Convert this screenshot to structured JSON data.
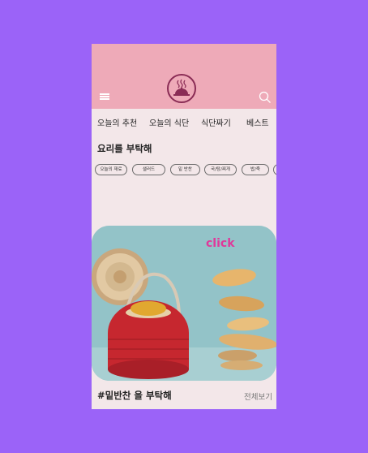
{
  "header": {
    "menu_icon": "hamburger-menu-icon",
    "logo_icon": "cloche-logo-icon",
    "search_icon": "search-icon"
  },
  "tabs": [
    {
      "label": "오늘의 추천"
    },
    {
      "label": "오늘의 식단"
    },
    {
      "label": "식단짜기"
    },
    {
      "label": "베스트"
    }
  ],
  "section": {
    "title": "요리를 부탁해"
  },
  "chips": [
    {
      "label": "오늘의 재료"
    },
    {
      "label": "샐러드"
    },
    {
      "label": "밑 반찬"
    },
    {
      "label": "국/탕/찌개"
    },
    {
      "label": "밥/죽"
    }
  ],
  "banner": {
    "click_label": "click"
  },
  "footer": {
    "title": "#밑반찬 을 부탁해",
    "see_all_label": "전체보기"
  },
  "colors": {
    "background": "#9b63f8",
    "header": "#eeaab8",
    "page": "#f3e7e9",
    "accent": "#e0389a",
    "logo": "#8a2c55"
  }
}
